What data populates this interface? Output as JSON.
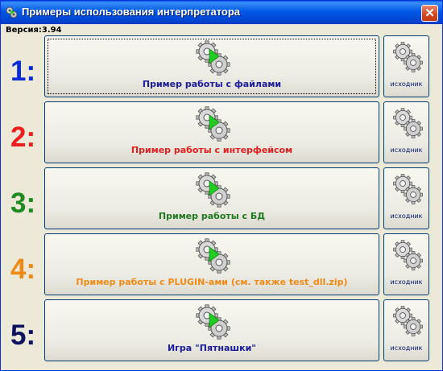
{
  "window": {
    "title": "Примеры использования интерпретатора",
    "close_glyph": "✕"
  },
  "version": "Версия:3.94",
  "rows": [
    {
      "number": "1:",
      "number_color": "#0a2cd6",
      "label": "Пример работы с файлами",
      "label_color": "#1a1a9c",
      "source_label": "исходник"
    },
    {
      "number": "2:",
      "number_color": "#ef1e1e",
      "label": "Пример работы с интерфейсом",
      "label_color": "#e02020",
      "source_label": "исходник"
    },
    {
      "number": "3:",
      "number_color": "#1f8a1f",
      "label": "Пример работы с БД",
      "label_color": "#1f7a1f",
      "source_label": "исходник"
    },
    {
      "number": "4:",
      "number_color": "#f08a16",
      "label": "Пример работы с PLUGIN-ами (см. также test_dll.zip)",
      "label_color": "#f08a16",
      "source_label": "исходник"
    },
    {
      "number": "5:",
      "number_color": "#0e1260",
      "label": "Игра \"Пятнашки\"",
      "label_color": "#1a1a9c",
      "source_label": "исходник"
    }
  ]
}
